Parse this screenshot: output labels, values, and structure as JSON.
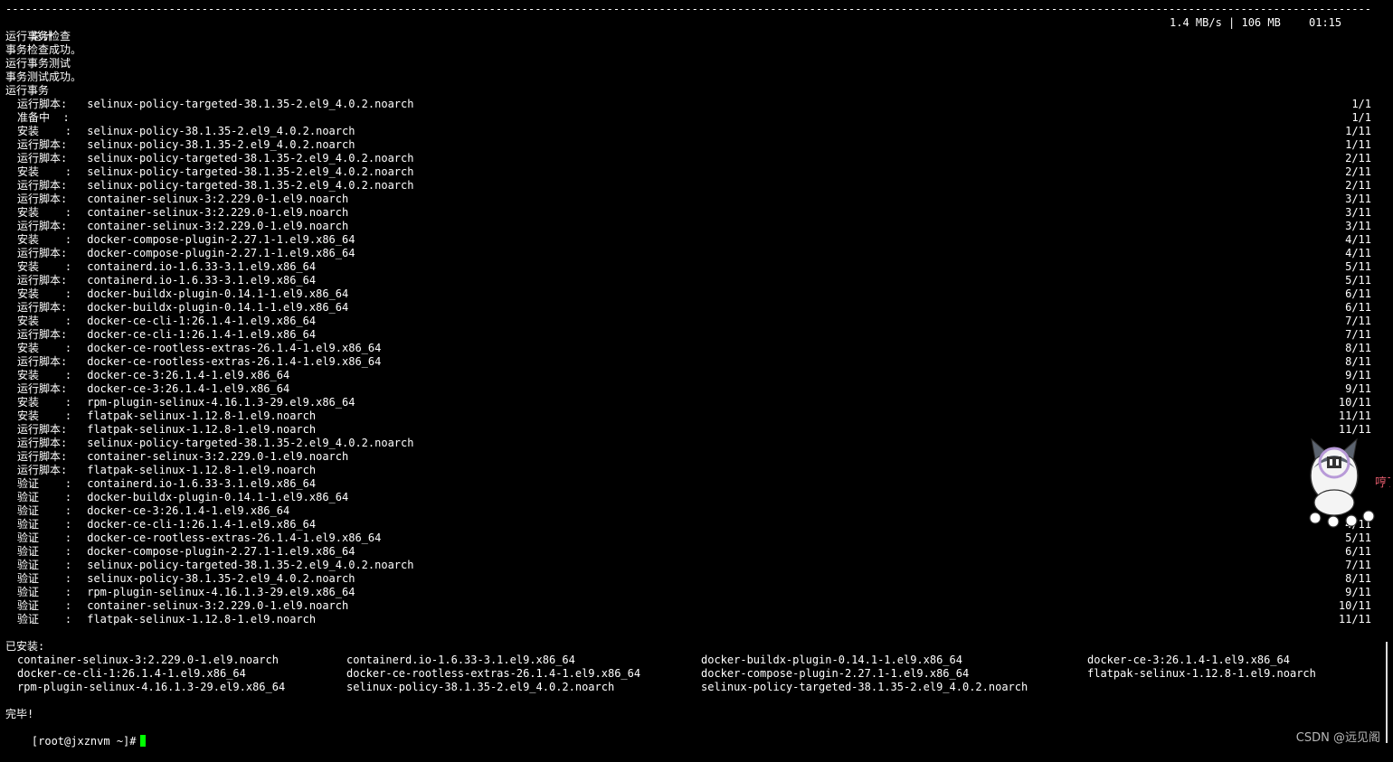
{
  "separator": "------------------------------------------------------------------------------------------------------------------------------------------------------------------------------------------------------------------------------------------------------------",
  "summary": {
    "label": "总计",
    "rate": "1.4 MB/s | 106 MB",
    "time": "01:15"
  },
  "status_lines": [
    "运行事务检查",
    "事务检查成功。",
    "运行事务测试",
    "事务测试成功。",
    "运行事务"
  ],
  "transaction_lines": [
    {
      "label": "运行脚本:",
      "package": "selinux-policy-targeted-38.1.35-2.el9_4.0.2.noarch",
      "progress": "1/1"
    },
    {
      "label": "准备中  :",
      "package": "",
      "progress": "1/1"
    },
    {
      "label": "安装    :",
      "package": "selinux-policy-38.1.35-2.el9_4.0.2.noarch",
      "progress": "1/11"
    },
    {
      "label": "运行脚本:",
      "package": "selinux-policy-38.1.35-2.el9_4.0.2.noarch",
      "progress": "1/11"
    },
    {
      "label": "运行脚本:",
      "package": "selinux-policy-targeted-38.1.35-2.el9_4.0.2.noarch",
      "progress": "2/11"
    },
    {
      "label": "安装    :",
      "package": "selinux-policy-targeted-38.1.35-2.el9_4.0.2.noarch",
      "progress": "2/11"
    },
    {
      "label": "运行脚本:",
      "package": "selinux-policy-targeted-38.1.35-2.el9_4.0.2.noarch",
      "progress": "2/11"
    },
    {
      "label": "运行脚本:",
      "package": "container-selinux-3:2.229.0-1.el9.noarch",
      "progress": "3/11"
    },
    {
      "label": "安装    :",
      "package": "container-selinux-3:2.229.0-1.el9.noarch",
      "progress": "3/11"
    },
    {
      "label": "运行脚本:",
      "package": "container-selinux-3:2.229.0-1.el9.noarch",
      "progress": "3/11"
    },
    {
      "label": "安装    :",
      "package": "docker-compose-plugin-2.27.1-1.el9.x86_64",
      "progress": "4/11"
    },
    {
      "label": "运行脚本:",
      "package": "docker-compose-plugin-2.27.1-1.el9.x86_64",
      "progress": "4/11"
    },
    {
      "label": "安装    :",
      "package": "containerd.io-1.6.33-3.1.el9.x86_64",
      "progress": "5/11"
    },
    {
      "label": "运行脚本:",
      "package": "containerd.io-1.6.33-3.1.el9.x86_64",
      "progress": "5/11"
    },
    {
      "label": "安装    :",
      "package": "docker-buildx-plugin-0.14.1-1.el9.x86_64",
      "progress": "6/11"
    },
    {
      "label": "运行脚本:",
      "package": "docker-buildx-plugin-0.14.1-1.el9.x86_64",
      "progress": "6/11"
    },
    {
      "label": "安装    :",
      "package": "docker-ce-cli-1:26.1.4-1.el9.x86_64",
      "progress": "7/11"
    },
    {
      "label": "运行脚本:",
      "package": "docker-ce-cli-1:26.1.4-1.el9.x86_64",
      "progress": "7/11"
    },
    {
      "label": "安装    :",
      "package": "docker-ce-rootless-extras-26.1.4-1.el9.x86_64",
      "progress": "8/11"
    },
    {
      "label": "运行脚本:",
      "package": "docker-ce-rootless-extras-26.1.4-1.el9.x86_64",
      "progress": "8/11"
    },
    {
      "label": "安装    :",
      "package": "docker-ce-3:26.1.4-1.el9.x86_64",
      "progress": "9/11"
    },
    {
      "label": "运行脚本:",
      "package": "docker-ce-3:26.1.4-1.el9.x86_64",
      "progress": "9/11"
    },
    {
      "label": "安装    :",
      "package": "rpm-plugin-selinux-4.16.1.3-29.el9.x86_64",
      "progress": "10/11"
    },
    {
      "label": "安装    :",
      "package": "flatpak-selinux-1.12.8-1.el9.noarch",
      "progress": "11/11"
    },
    {
      "label": "运行脚本:",
      "package": "flatpak-selinux-1.12.8-1.el9.noarch",
      "progress": "11/11"
    },
    {
      "label": "运行脚本:",
      "package": "selinux-policy-targeted-38.1.35-2.el9_4.0.2.noarch",
      "progress": ""
    },
    {
      "label": "运行脚本:",
      "package": "container-selinux-3:2.229.0-1.el9.noarch",
      "progress": ""
    },
    {
      "label": "运行脚本:",
      "package": "flatpak-selinux-1.12.8-1.el9.noarch",
      "progress": ""
    },
    {
      "label": "验证    :",
      "package": "containerd.io-1.6.33-3.1.el9.x86_64",
      "progress": ""
    },
    {
      "label": "验证    :",
      "package": "docker-buildx-plugin-0.14.1-1.el9.x86_64",
      "progress": ""
    },
    {
      "label": "验证    :",
      "package": "docker-ce-3:26.1.4-1.el9.x86_64",
      "progress": ""
    },
    {
      "label": "验证    :",
      "package": "docker-ce-cli-1:26.1.4-1.el9.x86_64",
      "progress": "4/11"
    },
    {
      "label": "验证    :",
      "package": "docker-ce-rootless-extras-26.1.4-1.el9.x86_64",
      "progress": "5/11"
    },
    {
      "label": "验证    :",
      "package": "docker-compose-plugin-2.27.1-1.el9.x86_64",
      "progress": "6/11"
    },
    {
      "label": "验证    :",
      "package": "selinux-policy-targeted-38.1.35-2.el9_4.0.2.noarch",
      "progress": "7/11"
    },
    {
      "label": "验证    :",
      "package": "selinux-policy-38.1.35-2.el9_4.0.2.noarch",
      "progress": "8/11"
    },
    {
      "label": "验证    :",
      "package": "rpm-plugin-selinux-4.16.1.3-29.el9.x86_64",
      "progress": "9/11"
    },
    {
      "label": "验证    :",
      "package": "container-selinux-3:2.229.0-1.el9.noarch",
      "progress": "10/11"
    },
    {
      "label": "验证    :",
      "package": "flatpak-selinux-1.12.8-1.el9.noarch",
      "progress": "11/11"
    }
  ],
  "installed": {
    "heading": "已安装:",
    "rows": [
      [
        "container-selinux-3:2.229.0-1.el9.noarch",
        "containerd.io-1.6.33-3.1.el9.x86_64",
        "docker-buildx-plugin-0.14.1-1.el9.x86_64",
        "docker-ce-3:26.1.4-1.el9.x86_64"
      ],
      [
        "docker-ce-cli-1:26.1.4-1.el9.x86_64",
        "docker-ce-rootless-extras-26.1.4-1.el9.x86_64",
        "docker-compose-plugin-2.27.1-1.el9.x86_64",
        "flatpak-selinux-1.12.8-1.el9.noarch"
      ],
      [
        "rpm-plugin-selinux-4.16.1.3-29.el9.x86_64",
        "selinux-policy-38.1.35-2.el9_4.0.2.noarch",
        "selinux-policy-targeted-38.1.35-2.el9_4.0.2.noarch",
        ""
      ]
    ]
  },
  "done_text": "完毕!",
  "prompt": "[root@jxznvm ~]#",
  "watermark": "CSDN @远见阁",
  "mascot": {
    "icon": "husky-mascot-icon",
    "caption": "哼了"
  },
  "colors": {
    "background": "#000000",
    "text": "#ffffff",
    "cursor": "#00ff00"
  }
}
